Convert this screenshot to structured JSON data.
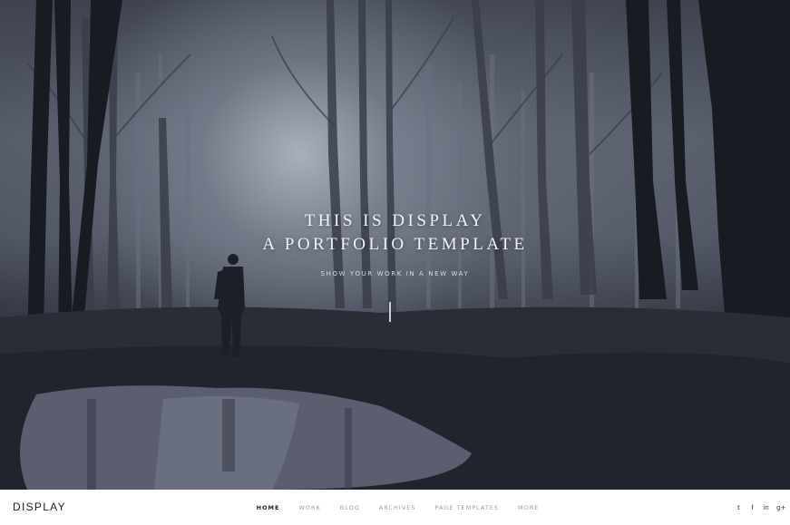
{
  "hero": {
    "title_line1": "THIS IS DISPLAY",
    "title_line2": "A PORTFOLIO TEMPLATE",
    "tagline": "SHOW YOUR WORK IN A NEW WAY"
  },
  "footer": {
    "logo": "DISPLAY",
    "nav": [
      {
        "label": "HOME",
        "active": true
      },
      {
        "label": "WORK",
        "active": false
      },
      {
        "label": "BLOG",
        "active": false
      },
      {
        "label": "ARCHIVES",
        "active": false
      },
      {
        "label": "PAGE TEMPLATES",
        "active": false
      },
      {
        "label": "MORE",
        "active": false
      }
    ],
    "social": [
      {
        "icon": "twitter-icon",
        "glyph": "t"
      },
      {
        "icon": "facebook-icon",
        "glyph": "f"
      },
      {
        "icon": "linkedin-icon",
        "glyph": "in"
      },
      {
        "icon": "google-plus-icon",
        "glyph": "g+"
      }
    ]
  },
  "colors": {
    "footer_background": "#ffffff",
    "active_nav": "#1e1e1e",
    "inactive_nav": "#9a9ca3",
    "hero_text": "#f2f2f4"
  }
}
